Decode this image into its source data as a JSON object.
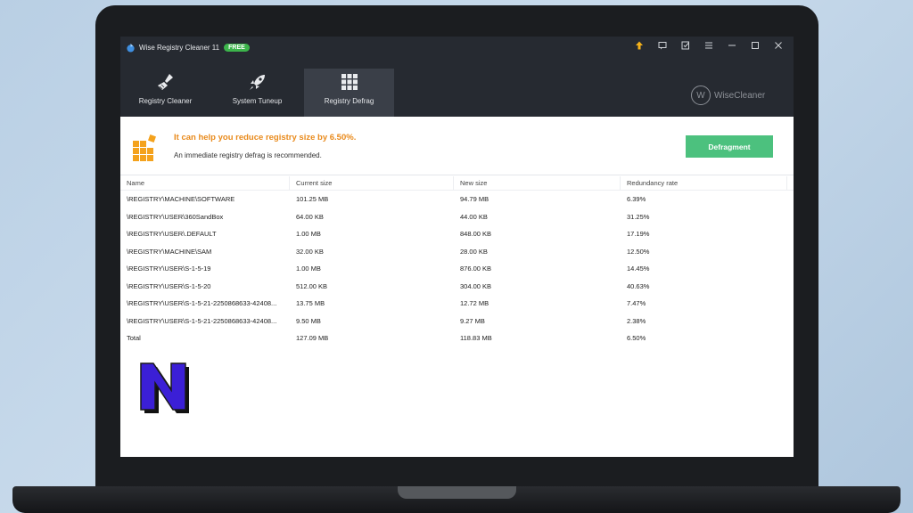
{
  "app": {
    "title": "Wise Registry Cleaner 11",
    "badge": "FREE",
    "brand": "WiseCleaner",
    "brand_mark": "W"
  },
  "nav": {
    "tabs": [
      {
        "label": "Registry Cleaner",
        "icon": "broom-icon"
      },
      {
        "label": "System Tuneup",
        "icon": "rocket-icon"
      },
      {
        "label": "Registry Defrag",
        "icon": "grid-icon",
        "active": true
      }
    ]
  },
  "window_controls": [
    "upgrade-icon",
    "feedback-icon",
    "checklist-icon",
    "menu-icon",
    "minimize-icon",
    "maximize-icon",
    "close-icon"
  ],
  "banner": {
    "headline": "It can help you reduce registry size by 6.50%.",
    "subtext": "An immediate registry defrag is recommended.",
    "button": "Defragment"
  },
  "table": {
    "headers": [
      "Name",
      "Current size",
      "New size",
      "Redundancy rate"
    ],
    "rows": [
      [
        "\\REGISTRY\\MACHINE\\SOFTWARE",
        "101.25 MB",
        "94.79 MB",
        "6.39%"
      ],
      [
        "\\REGISTRY\\USER\\360SandBox",
        "64.00 KB",
        "44.00 KB",
        "31.25%"
      ],
      [
        "\\REGISTRY\\USER\\.DEFAULT",
        "1.00 MB",
        "848.00 KB",
        "17.19%"
      ],
      [
        "\\REGISTRY\\MACHINE\\SAM",
        "32.00 KB",
        "28.00 KB",
        "12.50%"
      ],
      [
        "\\REGISTRY\\USER\\S-1-5-19",
        "1.00 MB",
        "876.00 KB",
        "14.45%"
      ],
      [
        "\\REGISTRY\\USER\\S-1-5-20",
        "512.00 KB",
        "304.00 KB",
        "40.63%"
      ],
      [
        "\\REGISTRY\\USER\\S-1-5-21-2250868633-42408...",
        "13.75 MB",
        "12.72 MB",
        "7.47%"
      ],
      [
        "\\REGISTRY\\USER\\S-1-5-21-2250868633-42408...",
        "9.50 MB",
        "9.27 MB",
        "2.38%"
      ],
      [
        "Total",
        "127.09 MB",
        "118.83 MB",
        "6.50%"
      ]
    ]
  },
  "overlay_logo": "N",
  "colors": {
    "accent_orange": "#e98a1b",
    "button_green": "#4cc17e",
    "titlebar": "#262a31",
    "badge_green": "#3cb44b",
    "logo_blue": "#3b1fd6"
  }
}
